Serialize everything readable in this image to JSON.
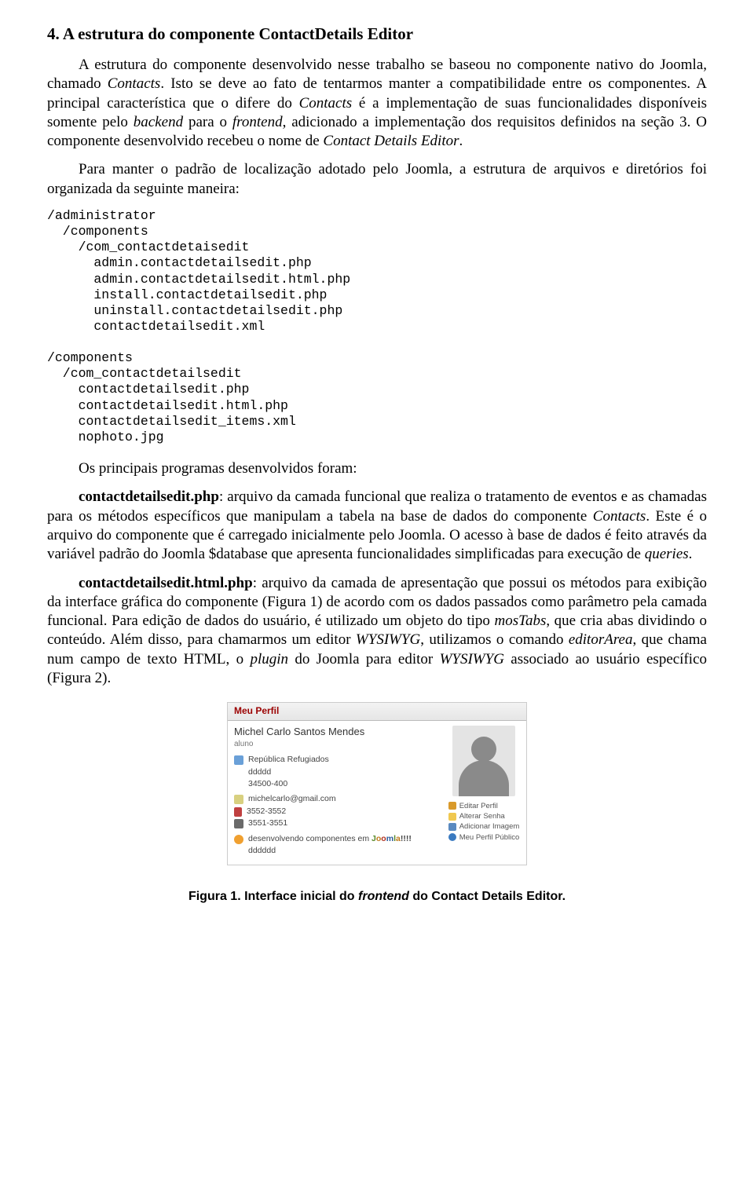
{
  "section": {
    "title": "4. A estrutura do componente ContactDetails Editor"
  },
  "para1_a": "A estrutura do componente desenvolvido nesse trabalho se baseou no componente nativo do Joomla, chamado ",
  "para1_b": "Contacts",
  "para1_c": ". Isto se deve ao fato de tentarmos manter a compatibilidade entre os componentes. A principal característica que o difere do ",
  "para1_d": "Contacts",
  "para1_e": " é a implementação de suas funcionalidades disponíveis somente pelo ",
  "para1_f": "backend",
  "para1_g": " para o ",
  "para1_h": "frontend",
  "para1_i": ", adicionado a implementação dos requisitos definidos na seção 3. O componente desenvolvido recebeu o nome de ",
  "para1_j": "Contact Details Editor",
  "para1_k": ".",
  "para2": "Para manter o padrão de localização adotado pelo Joomla, a estrutura de arquivos e diretórios foi organizada da seguinte maneira:",
  "code1": "/administrator\n  /components\n    /com_contactdetaisedit\n      admin.contactdetailsedit.php\n      admin.contactdetailsedit.html.php\n      install.contactdetailsedit.php\n      uninstall.contactdetailsedit.php\n      contactdetailsedit.xml\n\n/components\n  /com_contactdetailsedit\n    contactdetailsedit.php\n    contactdetailsedit.html.php\n    contactdetailsedit_items.xml\n    nophoto.jpg",
  "para3": "Os principais programas desenvolvidos foram:",
  "p4_lead": "contactdetailsedit.php",
  "p4_a": ": arquivo da camada funcional que realiza o tratamento de eventos e as chamadas para os métodos específicos que manipulam a tabela na base de dados do componente ",
  "p4_b": "Contacts",
  "p4_c": ". Este é o arquivo do componente que é carregado inicialmente pelo Joomla. O acesso à base de dados é feito através da variável padrão do Joomla $database que apresenta funcionalidades simplificadas para execução de ",
  "p4_d": "queries",
  "p4_e": ".",
  "p5_lead": "contactdetailsedit.html.php",
  "p5_a": ": arquivo da camada de apresentação que possui os métodos para exibição da interface gráfica do componente (Figura 1) de acordo com os dados passados como parâmetro pela camada funcional. Para edição de dados do usuário, é utilizado um objeto do tipo ",
  "p5_b": "mosTabs",
  "p5_c": ", que cria abas dividindo o conteúdo. Além disso, para chamarmos um editor ",
  "p5_d": "WYSIWYG",
  "p5_e": ", utilizamos o comando ",
  "p5_f": "editorArea",
  "p5_g": ", que chama num campo de texto HTML, o ",
  "p5_h": "plugin",
  "p5_i": " do Joomla para editor ",
  "p5_j": "WYSIWYG",
  "p5_k": " associado ao usuário específico (Figura 2).",
  "figure": {
    "header": "Meu Perfil",
    "name": "Michel Carlo Santos Mendes",
    "role": "aluno",
    "addr1": "República Refugiados",
    "addr2": "ddddd",
    "addr3": "34500-400",
    "email": "michelcarlo@gmail.com",
    "phone": "3552-3552",
    "fax": "3551-3551",
    "dev_a": "desenvolvendo componentes em ",
    "dev_b": "!!!!",
    "dd": "dddddd",
    "actions": {
      "edit": "Editar Perfil",
      "pass": "Alterar Senha",
      "img": "Adicionar Imagem",
      "pub": "Meu Perfil Público"
    }
  },
  "caption_a": "Figura 1. Interface inicial do ",
  "caption_b": "frontend",
  "caption_c": " do Contact Details Editor."
}
